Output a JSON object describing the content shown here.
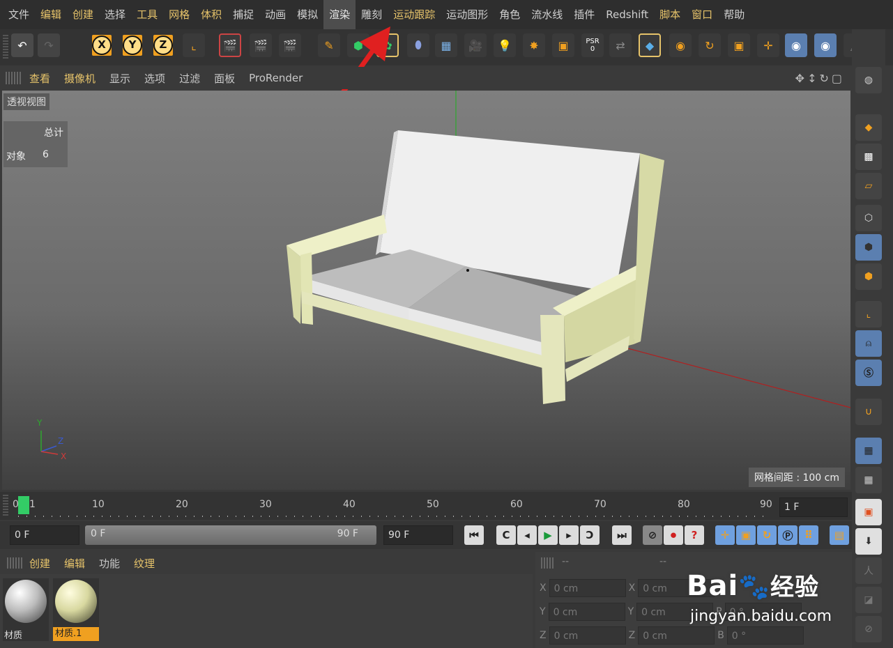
{
  "menubar": {
    "items": [
      "文件",
      "编辑",
      "创建",
      "选择",
      "工具",
      "网格",
      "体积",
      "捕捉",
      "动画",
      "模拟",
      "渲染",
      "雕刻",
      "运动跟踪",
      "运动图形",
      "角色",
      "流水线",
      "插件",
      "Redshift",
      "脚本",
      "窗口",
      "帮助"
    ]
  },
  "toolbar": {
    "x_label": "X",
    "y_label": "Y",
    "z_label": "Z",
    "psr_label": "PSR",
    "psr_value": "0"
  },
  "viewport_header": {
    "items": [
      "查看",
      "摄像机",
      "显示",
      "选项",
      "过滤",
      "面板",
      "ProRender"
    ]
  },
  "viewport": {
    "view_name": "透视视图",
    "stats_header": "总计",
    "stats_label": "对象",
    "stats_value": "6",
    "grid_spacing": "网格间距 : 100 cm",
    "axis_y": "Y",
    "axis_z": "Z",
    "axis_x": "X"
  },
  "timeline": {
    "start": "0",
    "current": "1",
    "ticks": [
      "10",
      "20",
      "30",
      "40",
      "50",
      "60",
      "70",
      "80",
      "90"
    ],
    "frame_field": "1 F"
  },
  "transport": {
    "start_field": "0 F",
    "range_start": "0 F",
    "range_end": "90 F",
    "end_field": "90 F"
  },
  "materials": {
    "menu": [
      "创建",
      "编辑",
      "功能",
      "纹理"
    ],
    "items": [
      {
        "label": "材质"
      },
      {
        "label": "材质.1"
      }
    ]
  },
  "attributes": {
    "header_a": "--",
    "header_b": "--",
    "rows": [
      {
        "l1": "X",
        "v1": "0 cm",
        "l2": "X",
        "v2": "0 cm"
      },
      {
        "l1": "Y",
        "v1": "0 cm",
        "l2": "Y",
        "v2": "0 cm",
        "l3": "P",
        "v3": "0 °"
      },
      {
        "l1": "Z",
        "v1": "0 cm",
        "l2": "Z",
        "v2": "0 cm",
        "l3": "B",
        "v3": "0 °"
      }
    ]
  },
  "watermark": {
    "brand": "Bai",
    "brand2": "经验",
    "url": "jingyan.baidu.com"
  },
  "colors": {
    "accent": "#e6c36a",
    "active_blue": "#5b7fb0",
    "arrow_red": "#e02020",
    "sofa_frame": "#e4e6bc",
    "playhead": "#33cc66"
  }
}
